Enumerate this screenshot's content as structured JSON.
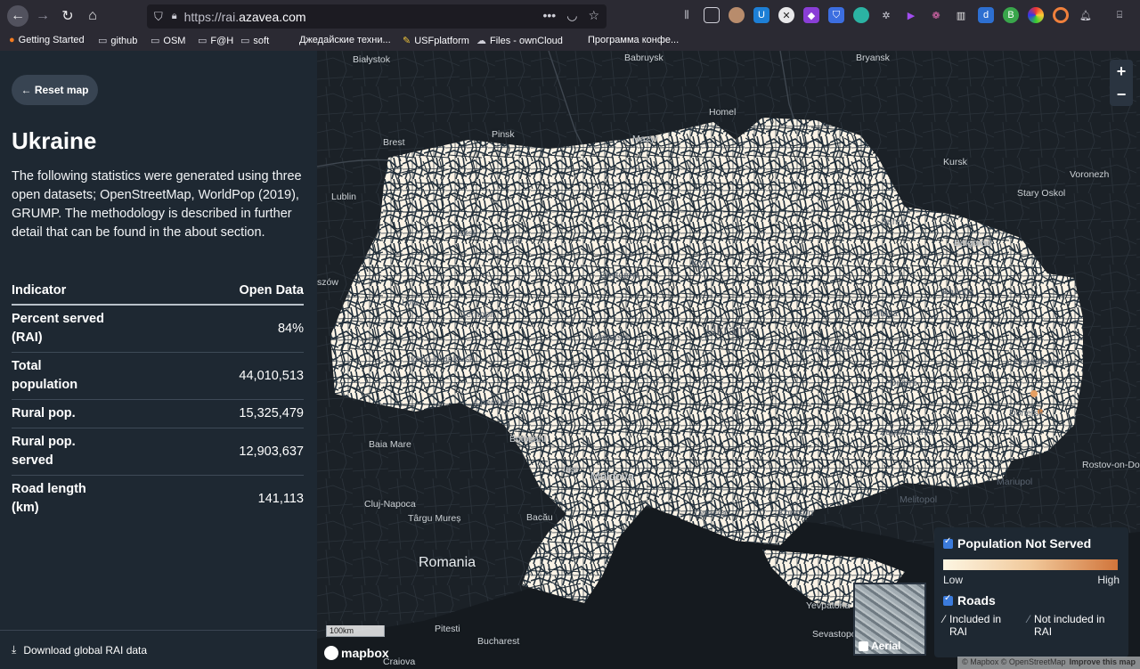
{
  "browser": {
    "url_prefix": "https://rai.",
    "url_domain": "azavea.com",
    "bookmarks": [
      {
        "label": "Getting Started",
        "icon": "firefox-icon"
      },
      {
        "label": "github",
        "icon": "folder-icon"
      },
      {
        "label": "OSM",
        "icon": "folder-icon"
      },
      {
        "label": "F@H",
        "icon": "folder-icon"
      },
      {
        "label": "soft",
        "icon": "folder-icon"
      },
      {
        "label": "Джедайские техни...",
        "icon": ""
      },
      {
        "label": "USFplatform",
        "icon": "bookmark-icon"
      },
      {
        "label": "Files - ownCloud",
        "icon": "cloud-icon"
      },
      {
        "label": "Программа конфе...",
        "icon": ""
      }
    ]
  },
  "sidebar": {
    "reset_label": "← Reset map",
    "country": "Ukraine",
    "description": "The following statistics were generated using three open datasets; OpenStreetMap, WorldPop (2019), GRUMP. The methodology is described in further detail that can be found in the about section.",
    "table": {
      "col_indicator": "Indicator",
      "col_value": "Open Data",
      "rows": [
        {
          "label": "Percent served (RAI)",
          "value": "84%"
        },
        {
          "label": "Total population",
          "value": "44,010,513"
        },
        {
          "label": "Rural pop.",
          "value": "15,325,479"
        },
        {
          "label": "Rural pop. served",
          "value": "12,903,637"
        },
        {
          "label": "Road length (km)",
          "value": "141,113"
        }
      ]
    },
    "download_label": "Download global RAI data"
  },
  "map": {
    "zoom_in": "+",
    "zoom_out": "−",
    "scale_label": "100km",
    "mapbox_label": "mapbox",
    "aerial_label": "Aerial",
    "attribution": "© Mapbox © OpenStreetMap",
    "improve_label": "Improve this map",
    "cities": {
      "bialystok": "Białystok",
      "babruysk": "Babruysk",
      "bryansk": "Bryansk",
      "homel": "Homel",
      "brest": "Brest",
      "pinsk": "Pinsk",
      "mazyr": "Mazyr",
      "kursk": "Kursk",
      "voronezh": "Voronezh",
      "lublin": "Lublin",
      "stary_oskol": "Stary Oskol",
      "lutsk": "Lutsk",
      "rivne": "Rivne",
      "sumy": "Sumy",
      "belgorod": "Belgorod",
      "zhytomyr": "Zhytomyr",
      "kyiv": "Kyiv",
      "rzeszow": "szów",
      "kharkiv": "Kharkiv",
      "lviv": "Lviv",
      "ternopil": "Ternopil",
      "poltava": "Poltava",
      "vinnytsia": "Vinnytsia",
      "ukraine": "Ukraine",
      "kremenchuk": "Kremenchuk",
      "ivano": "Ivano-Frankivsk",
      "lysychansk": "Lysychansk",
      "dnipro": "Dnipro",
      "chernivtsi": "Chernivtsi",
      "donetsk": "Donetsk",
      "baia_mare": "Baia Mare",
      "botosani": "Botoșani",
      "zaporizhzhia": "Zaporizhzhia",
      "iasi": "Iași",
      "rostov": "Rostov-on-Don",
      "moldova": "Moldova",
      "mariupol": "Mariupol",
      "cluj": "Cluj-Napoca",
      "odesa": "Odessa",
      "kherson": "Kherson",
      "melitopol": "Melitopol",
      "targu": "Târgu Mureș",
      "bacau": "Bacău",
      "romania": "Romania",
      "yevpatoria": "Yevpatoria",
      "pitesti": "Pitesti",
      "sevastopol": "Sevastopol",
      "bucharest": "Bucharest",
      "craiova": "Craiova"
    }
  },
  "legend": {
    "population_title": "Population Not Served",
    "low": "Low",
    "high": "High",
    "roads_title": "Roads",
    "included": "Included in RAI",
    "not_included": "Not included in RAI",
    "gradient_colors": [
      "#fdf6e3",
      "#f1c99b",
      "#d1753b"
    ]
  }
}
